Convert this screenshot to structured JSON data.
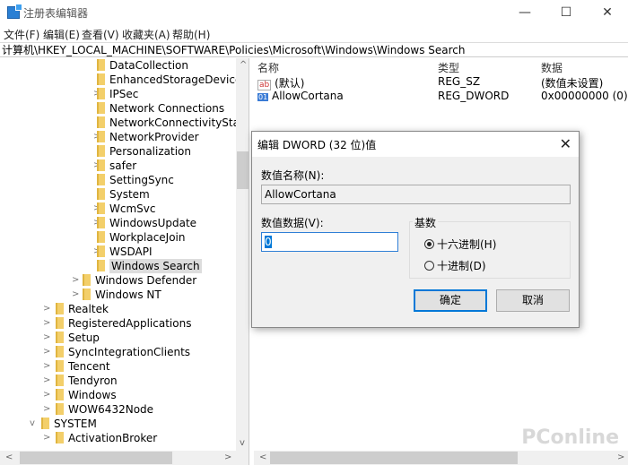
{
  "window": {
    "title": "注册表编辑器",
    "minimize": "—",
    "maximize": "☐",
    "close": "✕"
  },
  "menu": [
    "文件(F)",
    "编辑(E)",
    "查看(V)",
    "收藏夹(A)",
    "帮助(H)"
  ],
  "address": "计算机\\HKEY_LOCAL_MACHINE\\SOFTWARE\\Policies\\Microsoft\\Windows\\Windows Search",
  "tree": [
    {
      "label": "DataCollection",
      "level": 3,
      "expand": ""
    },
    {
      "label": "EnhancedStorageDevices",
      "level": 3,
      "expand": ""
    },
    {
      "label": "IPSec",
      "level": 3,
      "expand": ">"
    },
    {
      "label": "Network Connections",
      "level": 3,
      "expand": ""
    },
    {
      "label": "NetworkConnectivityStatus",
      "level": 3,
      "expand": ""
    },
    {
      "label": "NetworkProvider",
      "level": 3,
      "expand": ">"
    },
    {
      "label": "Personalization",
      "level": 3,
      "expand": ""
    },
    {
      "label": "safer",
      "level": 3,
      "expand": ">"
    },
    {
      "label": "SettingSync",
      "level": 3,
      "expand": ""
    },
    {
      "label": "System",
      "level": 3,
      "expand": ""
    },
    {
      "label": "WcmSvc",
      "level": 3,
      "expand": ">"
    },
    {
      "label": "WindowsUpdate",
      "level": 3,
      "expand": ">"
    },
    {
      "label": "WorkplaceJoin",
      "level": 3,
      "expand": ""
    },
    {
      "label": "WSDAPI",
      "level": 3,
      "expand": ">"
    },
    {
      "label": "Windows Search",
      "level": 3,
      "expand": "",
      "selected": true
    },
    {
      "label": "Windows Defender",
      "level": 2,
      "expand": ">"
    },
    {
      "label": "Windows NT",
      "level": 2,
      "expand": ">"
    },
    {
      "label": "Realtek",
      "level": 1,
      "expand": ">"
    },
    {
      "label": "RegisteredApplications",
      "level": 1,
      "expand": ">"
    },
    {
      "label": "Setup",
      "level": 1,
      "expand": ">"
    },
    {
      "label": "SyncIntegrationClients",
      "level": 1,
      "expand": ">"
    },
    {
      "label": "Tencent",
      "level": 1,
      "expand": ">"
    },
    {
      "label": "Tendyron",
      "level": 1,
      "expand": ">"
    },
    {
      "label": "Windows",
      "level": 1,
      "expand": ">"
    },
    {
      "label": "WOW6432Node",
      "level": 1,
      "expand": ">"
    },
    {
      "label": "SYSTEM",
      "level": 0,
      "expand": "v"
    },
    {
      "label": "ActivationBroker",
      "level": 1,
      "expand": ">"
    }
  ],
  "list": {
    "headers": [
      "名称",
      "类型",
      "数据"
    ],
    "rows": [
      {
        "icon": "ab",
        "name": "(默认)",
        "type": "REG_SZ",
        "data": "(数值未设置)"
      },
      {
        "icon": "01",
        "name": "AllowCortana",
        "type": "REG_DWORD",
        "data": "0x00000000 (0)"
      }
    ]
  },
  "dialog": {
    "title": "编辑 DWORD (32 位)值",
    "name_label": "数值名称(N):",
    "name_value": "AllowCortana",
    "data_label": "数值数据(V):",
    "data_value": "0",
    "base_label": "基数",
    "hex_label": "十六进制(H)",
    "dec_label": "十进制(D)",
    "base_selected": "hex",
    "ok": "确定",
    "cancel": "取消"
  },
  "watermark": "PConline"
}
